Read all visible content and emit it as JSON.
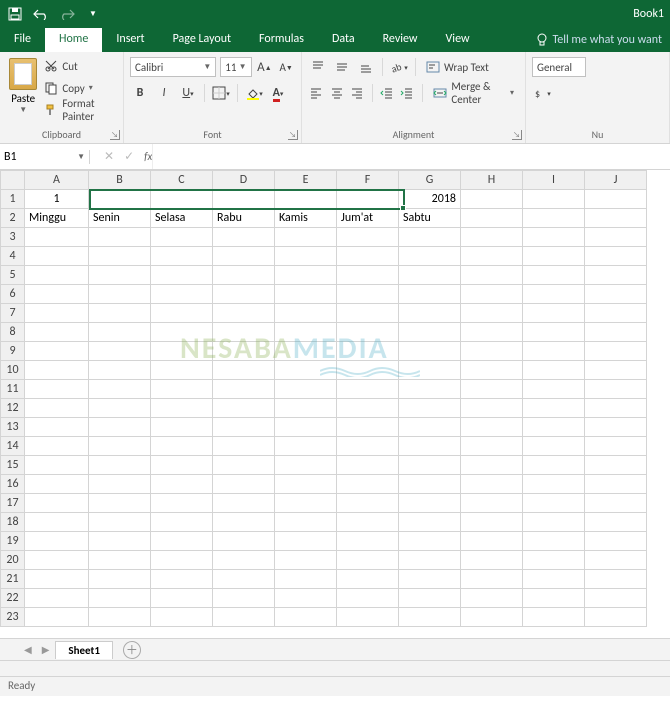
{
  "title": "Book1",
  "tabs": {
    "file": "File",
    "home": "Home",
    "insert": "Insert",
    "page_layout": "Page Layout",
    "formulas": "Formulas",
    "data": "Data",
    "review": "Review",
    "view": "View",
    "tellme": "Tell me what you want"
  },
  "clipboard": {
    "paste": "Paste",
    "cut": "Cut",
    "copy": "Copy",
    "format_painter": "Format Painter",
    "label": "Clipboard"
  },
  "font": {
    "name": "Calibri",
    "size": "11",
    "label": "Font"
  },
  "alignment": {
    "wrap": "Wrap Text",
    "merge": "Merge & Center",
    "label": "Alignment"
  },
  "number": {
    "format": "General",
    "label": "Nu"
  },
  "namebox": "B1",
  "fx": "fx",
  "columns": [
    "A",
    "B",
    "C",
    "D",
    "E",
    "F",
    "G",
    "H",
    "I",
    "J"
  ],
  "rows": [
    "1",
    "2",
    "3",
    "4",
    "5",
    "6",
    "7",
    "8",
    "9",
    "10",
    "11",
    "12",
    "13",
    "14",
    "15",
    "16",
    "17",
    "18",
    "19",
    "20",
    "21",
    "22",
    "23"
  ],
  "cells": {
    "A1": "1",
    "G1": "2018",
    "A2": "Minggu",
    "B2": "Senin",
    "C2": "Selasa",
    "D2": "Rabu",
    "E2": "Kamis",
    "F2": "Jum'at",
    "G2": "Sabtu"
  },
  "selection": {
    "ref": "B1:F1"
  },
  "sheet_tab": "Sheet1",
  "status": "Ready",
  "watermark": {
    "a": "NESABA",
    "b": "MEDIA"
  }
}
